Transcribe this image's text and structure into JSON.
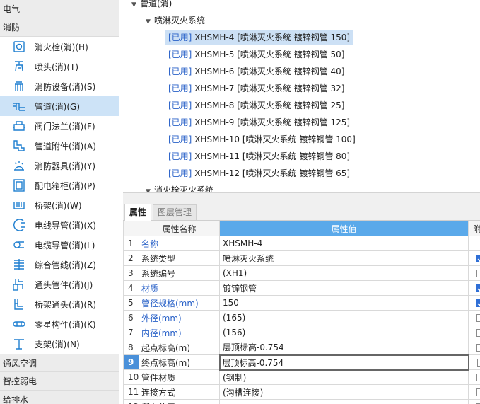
{
  "sidebar": {
    "categories": [
      {
        "label": "电气"
      },
      {
        "label": "消防"
      },
      {
        "label": "通风空调"
      },
      {
        "label": "智控弱电"
      },
      {
        "label": "给排水"
      }
    ],
    "items": [
      {
        "label": "消火栓(消)(H)",
        "icon": "hydrant-icon"
      },
      {
        "label": "喷头(消)(T)",
        "icon": "sprinkler-icon"
      },
      {
        "label": "消防设备(消)(S)",
        "icon": "fire-equipment-icon"
      },
      {
        "label": "管道(消)(G)",
        "icon": "pipe-icon",
        "selected": true
      },
      {
        "label": "阀门法兰(消)(F)",
        "icon": "valve-icon"
      },
      {
        "label": "管道附件(消)(A)",
        "icon": "pipe-fitting-icon"
      },
      {
        "label": "消防器具(消)(Y)",
        "icon": "fire-appliance-icon"
      },
      {
        "label": "配电箱柜(消)(P)",
        "icon": "distribution-box-icon"
      },
      {
        "label": "桥架(消)(W)",
        "icon": "cable-tray-icon"
      },
      {
        "label": "电线导管(消)(X)",
        "icon": "wire-conduit-icon"
      },
      {
        "label": "电缆导管(消)(L)",
        "icon": "cable-conduit-icon"
      },
      {
        "label": "综合管线(消)(Z)",
        "icon": "combined-lines-icon"
      },
      {
        "label": "通头管件(消)(J)",
        "icon": "tee-fitting-icon"
      },
      {
        "label": "桥架通头(消)(R)",
        "icon": "tray-tee-icon"
      },
      {
        "label": "零星构件(消)(K)",
        "icon": "misc-component-icon"
      },
      {
        "label": "支架(消)(N)",
        "icon": "support-icon"
      }
    ]
  },
  "tree": {
    "root_label": "管道(消)",
    "group_label": "喷淋灭火系统",
    "used_tag": "[已用]",
    "leaves": [
      "XHSMH-4 [喷淋灭火系统 镀锌钢管 150]",
      "XHSMH-5 [喷淋灭火系统 镀锌钢管 50]",
      "XHSMH-6 [喷淋灭火系统 镀锌钢管 40]",
      "XHSMH-7 [喷淋灭火系统 镀锌钢管 32]",
      "XHSMH-8 [喷淋灭火系统 镀锌钢管 25]",
      "XHSMH-9 [喷淋灭火系统 镀锌钢管 125]",
      "XHSMH-10 [喷淋灭火系统 镀锌钢管 100]",
      "XHSMH-11 [喷淋灭火系统 镀锌钢管 80]",
      "XHSMH-12 [喷淋灭火系统 镀锌钢管 65]"
    ],
    "next_group_label": "消火栓灭火系统"
  },
  "props": {
    "tabs": [
      "属性",
      "图层管理"
    ],
    "headers": {
      "name": "属性名称",
      "value": "属性值",
      "extra": "附"
    },
    "rows": [
      {
        "num": "1",
        "name": "名称",
        "value": "XHSMH-4",
        "blue": true,
        "check": "none"
      },
      {
        "num": "2",
        "name": "系统类型",
        "value": "喷淋灭火系统",
        "blue": false,
        "check": "on"
      },
      {
        "num": "3",
        "name": "系统编号",
        "value": "(XH1)",
        "blue": false,
        "check": "off"
      },
      {
        "num": "4",
        "name": "材质",
        "value": "镀锌钢管",
        "blue": true,
        "check": "on"
      },
      {
        "num": "5",
        "name": "管径规格(mm)",
        "value": "150",
        "blue": true,
        "check": "on"
      },
      {
        "num": "6",
        "name": "外径(mm)",
        "value": "(165)",
        "blue": true,
        "check": "off"
      },
      {
        "num": "7",
        "name": "内径(mm)",
        "value": "(156)",
        "blue": true,
        "check": "off"
      },
      {
        "num": "8",
        "name": "起点标高(m)",
        "value": "层顶标高-0.754",
        "blue": false,
        "check": "off"
      },
      {
        "num": "9",
        "name": "终点标高(m)",
        "value": "层顶标高-0.754",
        "blue": false,
        "check": "off",
        "selected": true
      },
      {
        "num": "10",
        "name": "管件材质",
        "value": "(钢制)",
        "blue": false,
        "check": "off"
      },
      {
        "num": "11",
        "name": "连接方式",
        "value": "(沟槽连接)",
        "blue": false,
        "check": "off"
      },
      {
        "num": "12",
        "name": "所在位置",
        "value": "",
        "blue": false,
        "check": "off"
      }
    ]
  }
}
